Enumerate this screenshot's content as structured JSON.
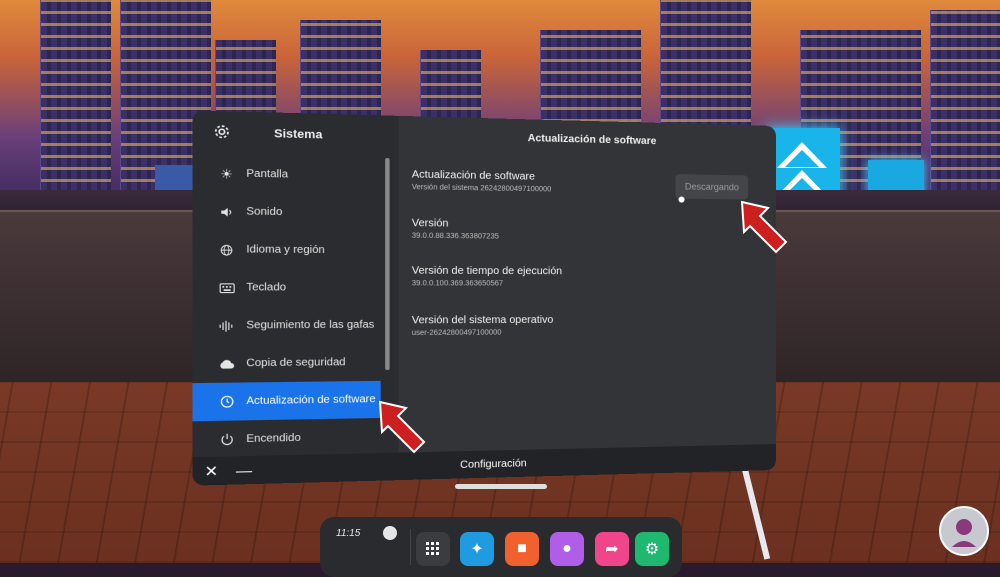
{
  "sidebar": {
    "title": "Sistema",
    "items": [
      {
        "label": "Pantalla",
        "icon": "brightness-icon"
      },
      {
        "label": "Sonido",
        "icon": "speaker-icon"
      },
      {
        "label": "Idioma y región",
        "icon": "globe-icon"
      },
      {
        "label": "Teclado",
        "icon": "keyboard-icon"
      },
      {
        "label": "Seguimiento de las gafas",
        "icon": "tracking-icon"
      },
      {
        "label": "Copia de seguridad",
        "icon": "cloud-icon"
      },
      {
        "label": "Actualización de software",
        "icon": "clock-icon",
        "active": true
      },
      {
        "label": "Encendido",
        "icon": "power-icon"
      }
    ]
  },
  "main": {
    "title": "Actualización de software",
    "software_update": {
      "title": "Actualización de software",
      "subtitle": "Versión del sistema 26242800497100000",
      "button": "Descargando"
    },
    "version": {
      "title": "Versión",
      "value": "39.0.0.88.336.363807235"
    },
    "runtime": {
      "title": "Versión de tiempo de ejecución",
      "value": "39.0.0.100.369.363650567"
    },
    "os": {
      "title": "Versión del sistema operativo",
      "value": "user-26242800497100000"
    }
  },
  "bottom_bar": {
    "label": "Configuración",
    "close": "✕",
    "minimize": "—"
  },
  "dock": {
    "time": "11:15"
  },
  "colors": {
    "accent": "#1a73e8",
    "arrow": "#cc1f1f",
    "panel": "#2b2c2f"
  }
}
